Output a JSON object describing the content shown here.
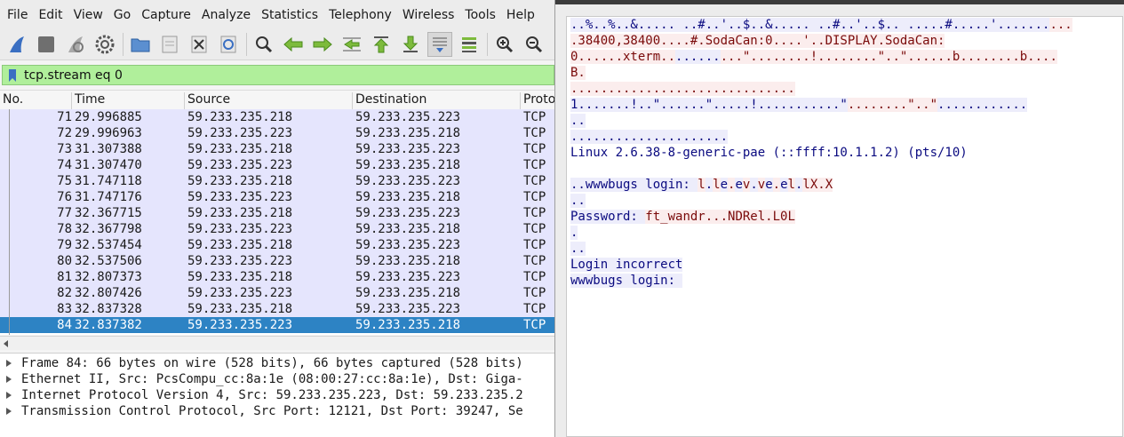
{
  "menubar": {
    "items": [
      "File",
      "Edit",
      "View",
      "Go",
      "Capture",
      "Analyze",
      "Statistics",
      "Telephony",
      "Wireless",
      "Tools",
      "Help"
    ]
  },
  "toolbar": {
    "icons": [
      "shark-fin-start-icon",
      "stop-square-icon",
      "restart-fin-icon",
      "gear-options-icon",
      "open-folder-icon",
      "save-file-icon",
      "close-file-icon",
      "reload-icon",
      "find-magnifier-icon",
      "go-back-arrow-icon",
      "go-forward-arrow-icon",
      "go-to-packet-icon",
      "first-packet-icon",
      "last-packet-icon",
      "autoscroll-icon",
      "colorize-icon",
      "zoom-in-icon",
      "zoom-out-icon"
    ]
  },
  "filter": {
    "value": "tcp.stream eq 0",
    "color": "#b0ef9b"
  },
  "packet_list": {
    "columns": [
      "No.",
      "Time",
      "Source",
      "Destination",
      "Protocol"
    ],
    "columns_visible": [
      "No.",
      "Time",
      "Source",
      "Destination",
      "Proto"
    ],
    "rows": [
      {
        "no": "71",
        "time": "29.996885",
        "src": "59.233.235.218",
        "dst": "59.233.235.223",
        "proto": "TCP"
      },
      {
        "no": "72",
        "time": "29.996963",
        "src": "59.233.235.223",
        "dst": "59.233.235.218",
        "proto": "TCP"
      },
      {
        "no": "73",
        "time": "31.307388",
        "src": "59.233.235.218",
        "dst": "59.233.235.223",
        "proto": "TCP"
      },
      {
        "no": "74",
        "time": "31.307470",
        "src": "59.233.235.223",
        "dst": "59.233.235.218",
        "proto": "TCP"
      },
      {
        "no": "75",
        "time": "31.747118",
        "src": "59.233.235.218",
        "dst": "59.233.235.223",
        "proto": "TCP"
      },
      {
        "no": "76",
        "time": "31.747176",
        "src": "59.233.235.223",
        "dst": "59.233.235.218",
        "proto": "TCP"
      },
      {
        "no": "77",
        "time": "32.367715",
        "src": "59.233.235.218",
        "dst": "59.233.235.223",
        "proto": "TCP"
      },
      {
        "no": "78",
        "time": "32.367798",
        "src": "59.233.235.223",
        "dst": "59.233.235.218",
        "proto": "TCP"
      },
      {
        "no": "79",
        "time": "32.537454",
        "src": "59.233.235.218",
        "dst": "59.233.235.223",
        "proto": "TCP"
      },
      {
        "no": "80",
        "time": "32.537506",
        "src": "59.233.235.223",
        "dst": "59.233.235.218",
        "proto": "TCP"
      },
      {
        "no": "81",
        "time": "32.807373",
        "src": "59.233.235.218",
        "dst": "59.233.235.223",
        "proto": "TCP"
      },
      {
        "no": "82",
        "time": "32.807426",
        "src": "59.233.235.223",
        "dst": "59.233.235.218",
        "proto": "TCP"
      },
      {
        "no": "83",
        "time": "32.837328",
        "src": "59.233.235.218",
        "dst": "59.233.235.223",
        "proto": "TCP"
      },
      {
        "no": "84",
        "time": "32.837382",
        "src": "59.233.235.223",
        "dst": "59.233.235.218",
        "proto": "TCP",
        "selected": true
      }
    ],
    "row_color": "#e5e5fd",
    "selected_color": "#2d83c4"
  },
  "details": [
    "Frame 84: 66 bytes on wire (528 bits), 66 bytes captured (528 bits)",
    "Ethernet II, Src: PcsCompu_cc:8a:1e (08:00:27:cc:8a:1e), Dst: Giga-",
    "Internet Protocol Version 4, Src: 59.233.235.223, Dst: 59.233.235.2",
    "Transmission Control Protocol, Src Port: 12121, Dst Port: 39247, Se"
  ],
  "stream": {
    "server_color": "#7a0a0a",
    "server_bg": "#fbeded",
    "client_color": "#0a0a80",
    "client_bg": "#ededfb",
    "lines": [
      {
        "segments": [
          {
            "t": "..%..%..&..... ..#..'..$..&..... ..#..'..$.. .....#.....'.......",
            "s": "cl"
          },
          {
            "t": "...",
            "s": "sv"
          }
        ]
      },
      {
        "segments": [
          {
            "t": ".38400,38400....#.SodaCan:0....'..DISPLAY.SodaCan:",
            "s": "sv"
          }
        ]
      },
      {
        "segments": [
          {
            "t": "0......xterm..",
            "s": "sv"
          },
          {
            "t": "......",
            "s": "cl"
          },
          {
            "t": "...\"........!........\"..\"......b........b....",
            "s": "sv"
          }
        ]
      },
      {
        "segments": [
          {
            "t": "B.",
            "s": "sv"
          }
        ]
      },
      {
        "segments": [
          {
            "t": "..............................",
            "s": "sv"
          }
        ]
      },
      {
        "segments": [
          {
            "t": "1.......!..\"......\".....!...........\"",
            "s": "cl"
          },
          {
            "t": "........\"..\"",
            "s": "sv"
          },
          {
            "t": "............",
            "s": "cl"
          }
        ]
      },
      {
        "segments": [
          {
            "t": "..",
            "s": "cl"
          }
        ]
      },
      {
        "segments": [
          {
            "t": ".....................",
            "s": "cl"
          }
        ]
      },
      {
        "segments": [
          {
            "t": "Linux 2.6.38-8-generic-pae (::ffff:10.1.1.2) (pts/10)",
            "s": "plain"
          }
        ]
      },
      {
        "segments": [
          {
            "t": "",
            "s": "plain"
          }
        ]
      },
      {
        "segments": [
          {
            "t": "..wwwbugs login: ",
            "s": "cl"
          },
          {
            "t": "l",
            "s": "sv"
          },
          {
            "t": ".",
            "s": "cl"
          },
          {
            "t": "l",
            "s": "sv"
          },
          {
            "t": "e",
            "s": "cl"
          },
          {
            "t": ".",
            "s": "sv"
          },
          {
            "t": "e",
            "s": "cl"
          },
          {
            "t": "v",
            "s": "sv"
          },
          {
            "t": ".",
            "s": "cl"
          },
          {
            "t": "v",
            "s": "sv"
          },
          {
            "t": "e",
            "s": "cl"
          },
          {
            "t": ".",
            "s": "sv"
          },
          {
            "t": "e",
            "s": "cl"
          },
          {
            "t": "l",
            "s": "sv"
          },
          {
            "t": ".",
            "s": "cl"
          },
          {
            "t": "lX.X",
            "s": "sv"
          }
        ]
      },
      {
        "segments": [
          {
            "t": "..",
            "s": "cl"
          }
        ]
      },
      {
        "segments": [
          {
            "t": "Password: ",
            "s": "cl"
          },
          {
            "t": "ft_wandr...NDRel.L0L",
            "s": "sv"
          }
        ]
      },
      {
        "segments": [
          {
            "t": ".",
            "s": "cl"
          }
        ]
      },
      {
        "segments": [
          {
            "t": "..",
            "s": "cl"
          }
        ]
      },
      {
        "segments": [
          {
            "t": "Login incorrect",
            "s": "cl"
          }
        ]
      },
      {
        "segments": [
          {
            "t": "wwwbugs login: ",
            "s": "cl"
          }
        ]
      }
    ]
  }
}
